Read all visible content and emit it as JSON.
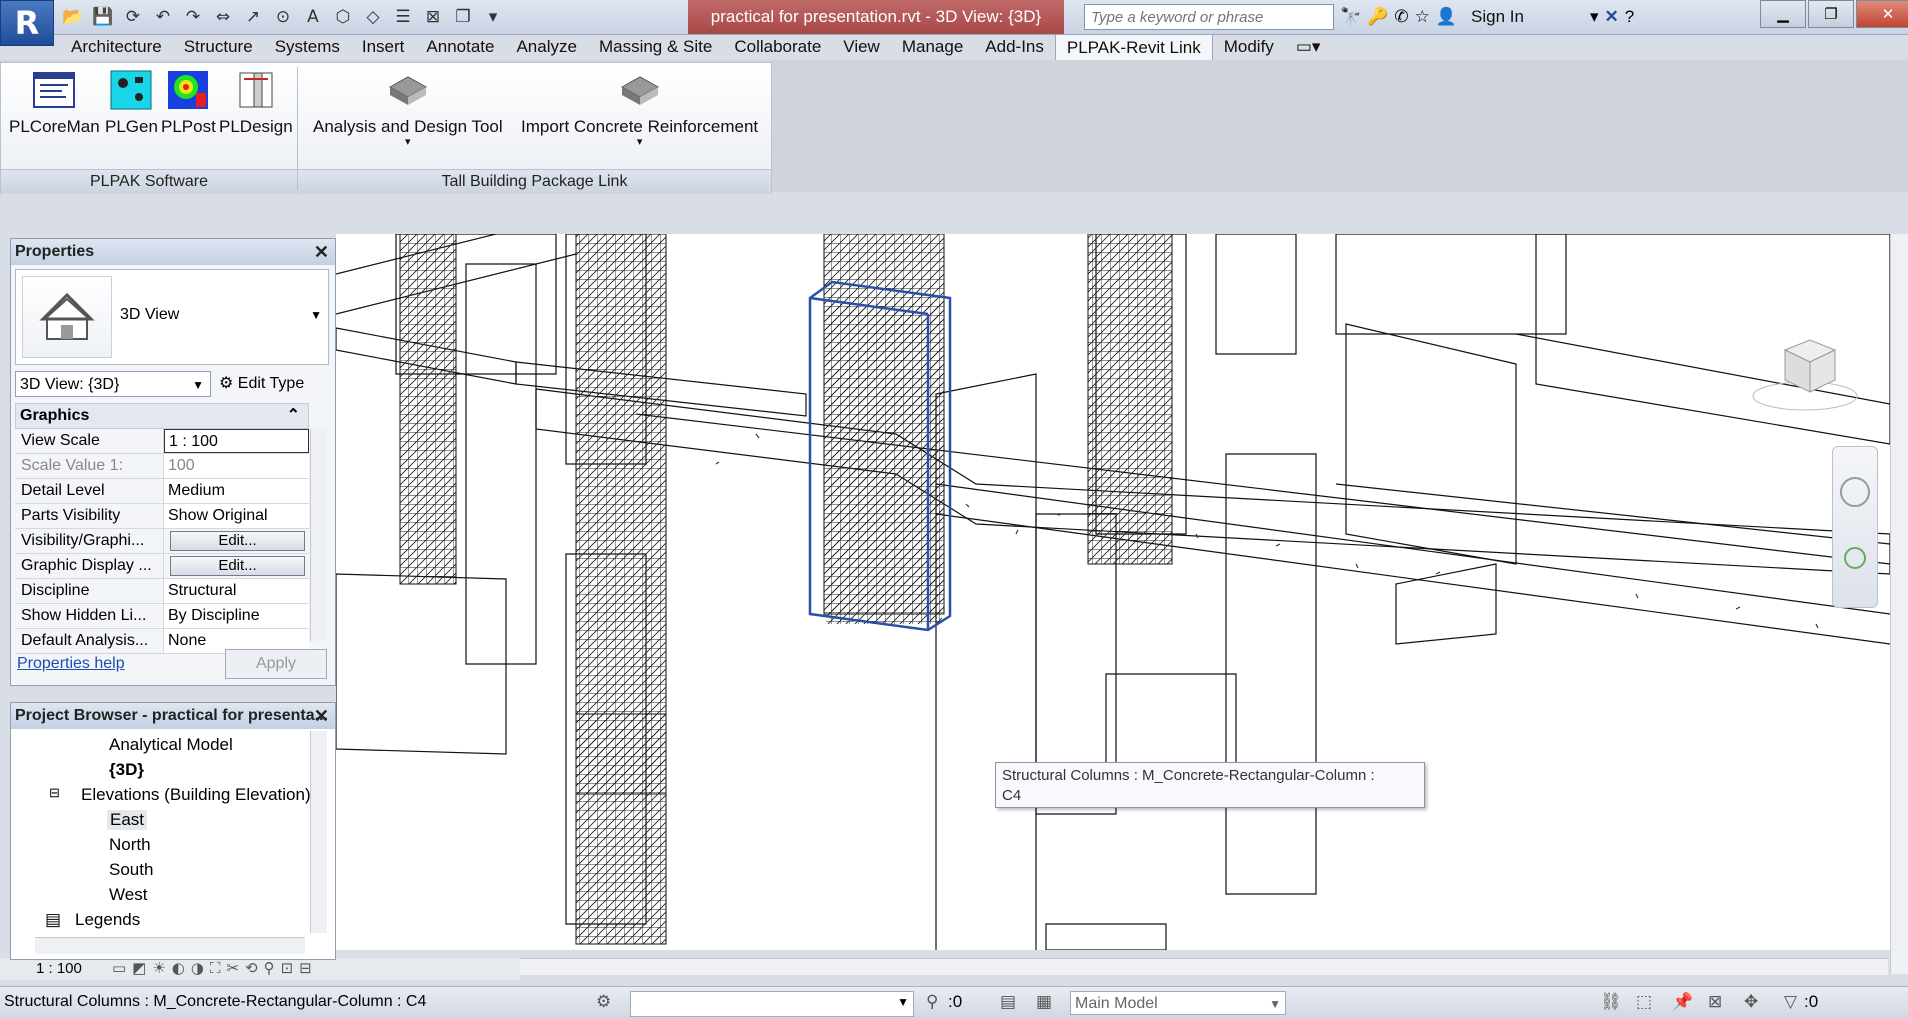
{
  "app": {
    "logo": "R",
    "document_title": "practical for presentation.rvt - 3D View: {3D}",
    "search_placeholder": "Type a keyword or phrase",
    "sign_in": "Sign In"
  },
  "ribbon": {
    "tabs": [
      "Architecture",
      "Structure",
      "Systems",
      "Insert",
      "Annotate",
      "Analyze",
      "Massing & Site",
      "Collaborate",
      "View",
      "Manage",
      "Add-Ins",
      "PLPAK-Revit Link",
      "Modify"
    ],
    "active_tab": "PLPAK-Revit Link",
    "buttons": {
      "plcoreman": "PLCoreMan",
      "plgen": "PLGen",
      "plpost": "PLPost",
      "pldesign": "PLDesign",
      "analysis_design": "Analysis and Design Tool",
      "import_rebar": "Import Concrete Reinforcement"
    },
    "panels": {
      "plpak_software": "PLPAK Software",
      "tall_building": "Tall Building Package Link"
    }
  },
  "properties": {
    "title": "Properties",
    "type_name": "3D View",
    "view_selector": "3D View: {3D}",
    "edit_type": "Edit Type",
    "group": "Graphics",
    "rows": [
      {
        "k": "View Scale",
        "v": "1 : 100"
      },
      {
        "k": "Scale Value    1:",
        "v": "100"
      },
      {
        "k": "Detail Level",
        "v": "Medium"
      },
      {
        "k": "Parts Visibility",
        "v": "Show Original"
      },
      {
        "k": "Visibility/Graphi...",
        "v": "Edit..."
      },
      {
        "k": "Graphic Display ...",
        "v": "Edit..."
      },
      {
        "k": "Discipline",
        "v": "Structural"
      },
      {
        "k": "Show Hidden Li...",
        "v": "By Discipline"
      },
      {
        "k": "Default Analysis...",
        "v": "None"
      }
    ],
    "help": "Properties help",
    "apply": "Apply"
  },
  "browser": {
    "title": "Project Browser - practical for presenta...",
    "items": {
      "analytical": "Analytical Model",
      "view3d": "{3D}",
      "elevations": "Elevations (Building Elevation)",
      "east": "East",
      "north": "North",
      "south": "South",
      "west": "West",
      "legends": "Legends"
    }
  },
  "viewbar": {
    "scale": "1 : 100"
  },
  "tooltip": {
    "line1": "Structural Columns : M_Concrete-Rectangular-Column :",
    "line2": "C4"
  },
  "status": {
    "text": "Structural Columns : M_Concrete-Rectangular-Column : C4",
    "sync_count": ":0",
    "model": "Main Model",
    "filter_count": ":0"
  },
  "colors": {
    "selection": "#2a4fa8",
    "active_title": "#a84848"
  }
}
